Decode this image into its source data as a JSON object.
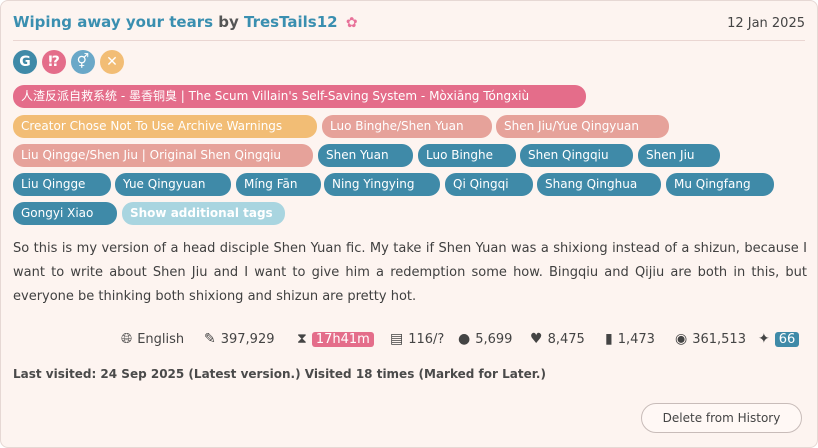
{
  "work": {
    "title": "Wiping away your tears",
    "by_text": "by",
    "author": "TresTails12",
    "date": "12 Jan 2025"
  },
  "required_icons": [
    {
      "symbol": "G",
      "name": "rating-general-icon",
      "color": "#3f8aa8"
    },
    {
      "symbol": "⁉",
      "name": "warning-icon",
      "color": "#e46d8a"
    },
    {
      "symbol": "⚥",
      "name": "category-multi-icon",
      "color": "#6aa8c8"
    },
    {
      "symbol": "✕",
      "name": "complete-status-icon",
      "color": "#f2bd75"
    }
  ],
  "tags": {
    "fandom": "人渣反派自救系统 - 墨香铜臭 | The Scum Villain's Self-Saving System - Mòxiāng Tóngxiù",
    "warning": "Creator Chose Not To Use Archive Warnings",
    "relationships": [
      "Luo Binghe/Shen Yuan",
      "Shen Jiu/Yue Qingyuan",
      "Liu Qingge/Shen Jiu | Original Shen Qingqiu"
    ],
    "characters": [
      "Shen Yuan",
      "Luo Binghe",
      "Shen Qingqiu",
      "Shen Jiu",
      "Liu Qingge",
      "Yue Qingyuan",
      "Míng Fān",
      "Ning Yingying",
      "Qi Qingqi",
      "Shang Qinghua",
      "Mu Qingfang",
      "Gongyi Xiao"
    ],
    "show_more": "Show additional tags"
  },
  "summary": "So this is my version of a head disciple Shen Yuan fic. My take if Shen Yuan was a shixiong instead of a shizun, because I want to write about Shen Jiu and I want to give him a redemption some how. Bingqiu and Qijiu are both in this, but everyone be thinking both shixiong and shizun are pretty hot.",
  "stats": {
    "language": "English",
    "words": "397,929",
    "reading_time": "17h41m",
    "chapters": "116/?",
    "comments": "5,699",
    "kudos": "8,475",
    "bookmarks": "1,473",
    "hits": "361,513",
    "extra": "66"
  },
  "visited": "Last visited: 24 Sep 2025 (Latest version.) Visited 18 times (Marked for Later.)",
  "delete_button": "Delete from History",
  "colors": {
    "title": "#3a8fb0",
    "fandom_tag": "#e46d8a",
    "warning_tag": "#f2bd75",
    "relationship_tag": "#e6a29a",
    "character_tag": "#3f8aa8",
    "more_tag": "#a9d5e0",
    "card_bg": "#fdf4f0"
  }
}
